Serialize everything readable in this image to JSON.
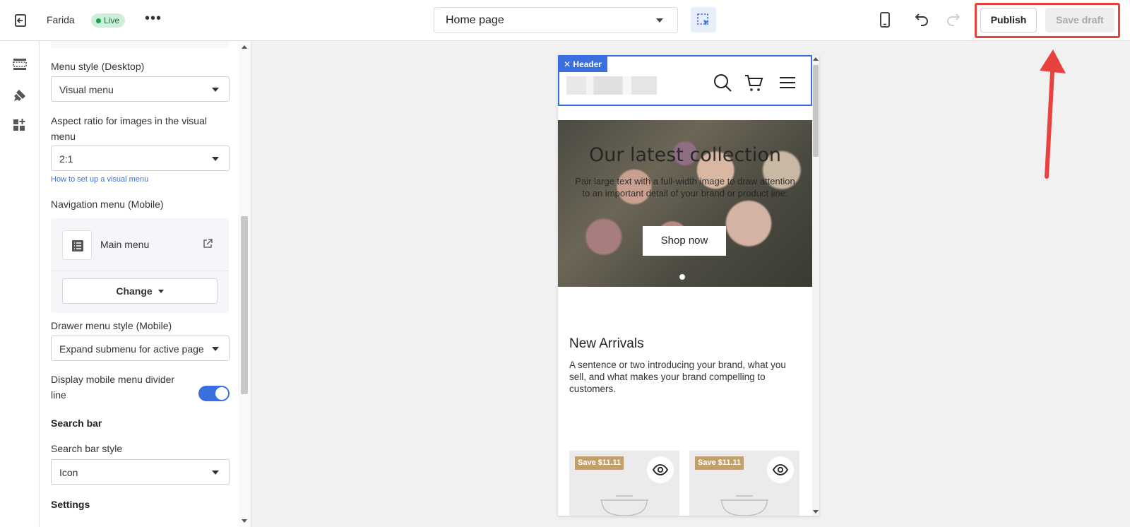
{
  "topbar": {
    "store_name": "Farida",
    "status_badge": "Live",
    "page_selector": "Home page",
    "publish_label": "Publish",
    "save_draft_label": "Save draft"
  },
  "icons": {
    "exit": "exit-icon",
    "more": "more-horizontal-icon",
    "select_tool": "select-element-icon",
    "mobile": "mobile-device-icon",
    "undo": "undo-icon",
    "redo": "redo-icon",
    "rail": [
      "sections-icon",
      "theme-style-icon",
      "add-app-icon"
    ]
  },
  "panel": {
    "menu_style_label": "Menu style (Desktop)",
    "menu_style_value": "Visual menu",
    "aspect_label": "Aspect ratio for images in the visual menu",
    "aspect_value": "2:1",
    "help_link": "How to set up a visual menu",
    "nav_label": "Navigation menu (Mobile)",
    "nav_menu_name": "Main menu",
    "change_label": "Change",
    "drawer_label": "Drawer menu style (Mobile)",
    "drawer_value": "Expand submenu for active page",
    "divider_label": "Display mobile menu divider line",
    "divider_on": true,
    "search_heading": "Search bar",
    "search_style_label": "Search bar style",
    "search_style_value": "Icon",
    "settings_heading": "Settings"
  },
  "preview": {
    "header_tag": "Header",
    "hero_title": "Our latest collection",
    "hero_subtitle": "Pair large text with a full-width image to draw attention to an important detail of your brand or product line.",
    "hero_button": "Shop now",
    "section_title": "New Arrivals",
    "section_text": "A sentence or two introducing your brand, what you sell, and what makes your brand compelling to customers.",
    "products": [
      {
        "badge": "Save $11.11"
      },
      {
        "badge": "Save $11.11"
      }
    ]
  },
  "colors": {
    "accent": "#3b6fe0",
    "live_badge": "#cdefd9",
    "annotation_red": "#e8423f",
    "save_badge": "#c1a06e"
  }
}
